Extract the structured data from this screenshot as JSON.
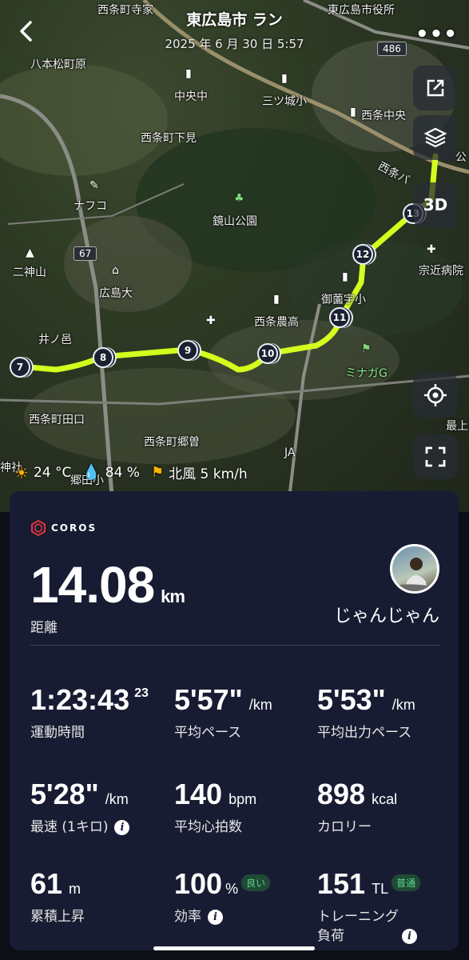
{
  "header": {
    "title": "東広島市 ラン",
    "date": "2025 年 6 月 30 日 5:57"
  },
  "map": {
    "labels": {
      "saijo_teraie": "西条町寺家",
      "higashihiroshima_office": "東広島市役所",
      "hachihonmatsu": "八本松町原",
      "chuo_chu": "中央中",
      "mitsujo": "三ツ城小",
      "saijo_chuo": "西条中央",
      "saijo_shimomi": "西条町下見",
      "nafuko": "ナフコ",
      "kagamiyama": "鏡山公園",
      "nikamiyama": "二神山",
      "hirodai": "広島大",
      "munechika": "宗近病院",
      "misono": "御薗宇小",
      "saijo_nouko": "西条農高",
      "inoyu": "井ノ邑",
      "minaga": "ミナガG",
      "saijo_taguchi": "西条町田口",
      "saijo_gouso": "西条町郷曽",
      "ja": "JA",
      "gouta": "郷田小",
      "saijo_ba": "西条バ",
      "ko": "公",
      "kami": "神社",
      "mo": "最上"
    },
    "route_badges": {
      "r486": "486",
      "r67": "67"
    },
    "laps": [
      "7",
      "8",
      "9",
      "10",
      "11",
      "12",
      "13"
    ],
    "route_color": "#d4ff1e",
    "buttons": {
      "three_d": "3D"
    }
  },
  "weather": {
    "temperature": "24 °C",
    "humidity": "84 %",
    "wind": "北風 5 km/h"
  },
  "card": {
    "brand": "COROS",
    "distance": {
      "value": "14.08",
      "unit": "km",
      "label": "距離"
    },
    "username": "じゃんじゃん",
    "stats": {
      "duration": {
        "value": "1:23:43",
        "sup": "23",
        "label": "運動時間"
      },
      "avg_pace": {
        "value": "5'57\"",
        "unit": "/km",
        "label": "平均ペース"
      },
      "avg_power_pace": {
        "value": "5'53\"",
        "unit": "/km",
        "label": "平均出力ペース"
      },
      "fastest": {
        "value": "5'28\"",
        "unit": "/km",
        "label": "最速 (1キロ)"
      },
      "avg_hr": {
        "value": "140",
        "unit": "bpm",
        "label": "平均心拍数"
      },
      "calories": {
        "value": "898",
        "unit": "kcal",
        "label": "カロリー"
      },
      "elevation": {
        "value": "61",
        "unit": "m",
        "label": "累積上昇"
      },
      "efficiency": {
        "value": "100",
        "unit": "%",
        "badge": "良い",
        "label": "効率"
      },
      "training_load": {
        "value": "151",
        "unit": "TL",
        "badge": "普通",
        "label1": "トレーニング",
        "label2": "負荷"
      }
    }
  }
}
